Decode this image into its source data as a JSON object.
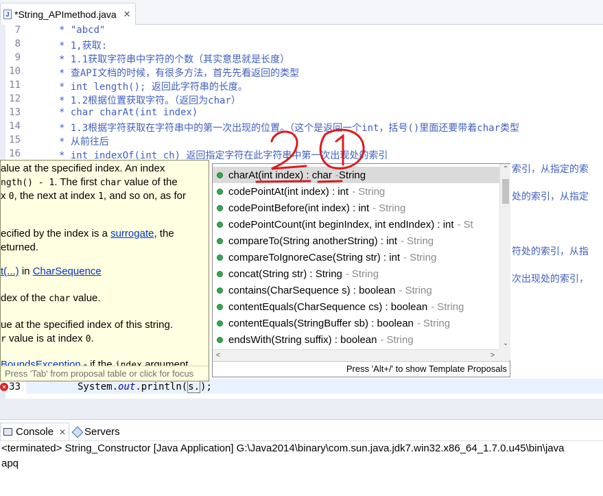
{
  "editor_tab": {
    "icon": "java-file-icon",
    "title": "*String_APImethod.java",
    "close": "✕"
  },
  "code_lines": [
    {
      "num": "7",
      "text": "* \"abcd\""
    },
    {
      "num": "8",
      "text": "* 1,获取:"
    },
    {
      "num": "9",
      "text": "* 1.1获取字符串中字符的个数（其实意思就是长度）"
    },
    {
      "num": "10",
      "text": "* 查API文档的时候，有很多方法，首先先看返回的类型"
    },
    {
      "num": "11",
      "text": "* int length(); 返回此字符串的长度。"
    },
    {
      "num": "12",
      "text": "* 1.2根据位置获取字符。（返回为char）"
    },
    {
      "num": "13",
      "text": "* char charAt(int index)"
    },
    {
      "num": "14",
      "text": "* 1.3根据字符获取在字符串中的第一次出现的位置。（这个是返回一个int，括号()里面还要带着char类型"
    },
    {
      "num": "15",
      "text": "* 从前往后"
    },
    {
      "num": "16",
      "text": "* int indexOf(int ch) 返回指定字符在此字符串中第一次出现处的索引"
    }
  ],
  "right_fragments": [
    "索引，从指定的索",
    "处的索引，从指定",
    "符处的索引，从指",
    "次出现处的索引，"
  ],
  "line33": {
    "num": "33",
    "pre": "System.",
    "out": "out",
    "mid": ".println(",
    "sel": "s.",
    "post": ");"
  },
  "javadoc": {
    "lines": [
      {
        "t": "alue at the specified index. An index"
      },
      {
        "mono": "ngth() - 1",
        "t": ". The first ",
        "mono2": "char",
        "t2": " value of the"
      },
      {
        "t": "x ",
        "mono": "0",
        "t2": ", the next at index ",
        "mono2": "1",
        "t3": ", and so on, as for"
      },
      {
        "t": "ecified by the index is a ",
        "link": "surrogate",
        "t2": ", the"
      },
      {
        "t": "eturned."
      },
      {
        "link": "t(...)",
        "t": " in ",
        "link2": "CharSequence"
      },
      {
        "t": "dex of the ",
        "mono": "char",
        "t2": " value."
      },
      {
        "t": "ue at the specified index of this string."
      },
      {
        "mono": "r",
        "t": " value is at index ",
        "mono2": "0",
        "t2": "."
      },
      {
        "link": "BoundsException",
        "t": " - if the ",
        "mono": "index",
        "t2": " argument"
      }
    ],
    "status": "Press 'Tab' from proposal table or click for focus"
  },
  "proposals": {
    "items": [
      {
        "sig": "charAt(int index) : char",
        "owner": "String",
        "selected": true
      },
      {
        "sig": "codePointAt(int index) : int",
        "owner": "String"
      },
      {
        "sig": "codePointBefore(int index) : int",
        "owner": "String"
      },
      {
        "sig": "codePointCount(int beginIndex, int endIndex) : int",
        "owner": "St"
      },
      {
        "sig": "compareTo(String anotherString) : int",
        "owner": "String"
      },
      {
        "sig": "compareToIgnoreCase(String str) : int",
        "owner": "String"
      },
      {
        "sig": "concat(String str) : String",
        "owner": "String"
      },
      {
        "sig": "contains(CharSequence s) : boolean",
        "owner": "String"
      },
      {
        "sig": "contentEquals(CharSequence cs) : boolean",
        "owner": "String"
      },
      {
        "sig": "contentEquals(StringBuffer sb) : boolean",
        "owner": "String"
      },
      {
        "sig": "endsWith(String suffix) : boolean",
        "owner": "String"
      }
    ],
    "footer": "Press 'Alt+/' to show Template Proposals",
    "scroll_up": "⌃",
    "scroll_down": "⌄",
    "scroll_left": "<",
    "scroll_right": ">"
  },
  "bottom_panel": {
    "tabs": [
      {
        "label": "Console",
        "icon": "console-icon",
        "close": "✕",
        "active": true
      },
      {
        "label": "Servers",
        "icon": "servers-icon"
      }
    ],
    "console_lines": [
      "<terminated> String_Constructor [Java Application] G:\\Java2014\\binary\\com.sun.java.jdk7.win32.x86_64_1.7.0.u45\\bin\\java",
      "apq"
    ]
  },
  "colors": {
    "comment": "#3f5fbf",
    "annotation_red": "#e0181d",
    "tooltip_bg": "#ffffe1",
    "selection": "#dadada"
  }
}
